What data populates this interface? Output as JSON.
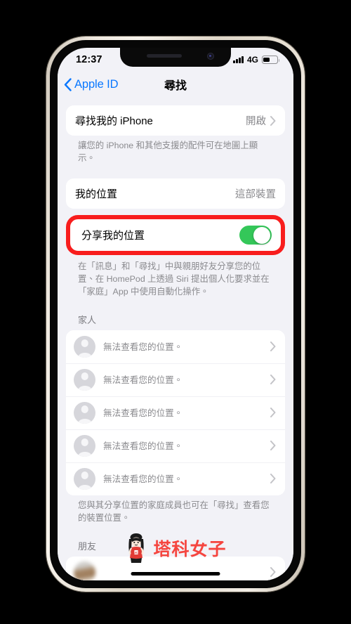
{
  "status_bar": {
    "time": "12:37",
    "network": "4G",
    "signal_icon": "cellular-bars-icon",
    "battery_icon": "battery-icon",
    "battery_level_percent": 48
  },
  "nav": {
    "back_label": "Apple ID",
    "back_icon": "chevron-left-icon",
    "title": "尋找"
  },
  "find_my_section": {
    "row_title": "尋找我的 iPhone",
    "row_value": "開啟",
    "chevron_icon": "chevron-right-icon",
    "footnote": "讓您的 iPhone 和其他支援的配件可在地圖上顯示。"
  },
  "my_location_section": {
    "row_title": "我的位置",
    "row_value": "這部裝置"
  },
  "share_location": {
    "row_title": "分享我的位置",
    "toggle_state": "on",
    "toggle_color": "#34c759",
    "highlight_color": "#f81d1d",
    "footnote": "在「訊息」和「尋找」中與親朋好友分享您的位置、在 HomePod 上透過 Siri 提出個人化要求並在「家庭」App 中使用自動化操作。"
  },
  "family": {
    "header": "家人",
    "members": [
      {
        "name": "",
        "name_blurred": true,
        "subtitle": "無法查看您的位置。",
        "avatar": "person-placeholder-icon",
        "chevron_icon": "chevron-right-icon"
      },
      {
        "name": "",
        "name_blurred": true,
        "subtitle": "無法查看您的位置。",
        "avatar": "person-placeholder-icon",
        "chevron_icon": "chevron-right-icon"
      },
      {
        "name": "",
        "name_blurred": true,
        "subtitle": "無法查看您的位置。",
        "avatar": "person-placeholder-icon",
        "chevron_icon": "chevron-right-icon"
      },
      {
        "name": "",
        "name_blurred": true,
        "subtitle": "無法查看您的位置。",
        "avatar": "person-placeholder-icon",
        "chevron_icon": "chevron-right-icon"
      },
      {
        "name": "",
        "name_blurred": true,
        "subtitle": "無法查看您的位置。",
        "avatar": "person-placeholder-icon",
        "chevron_icon": "chevron-right-icon"
      }
    ],
    "footnote": "您與其分享位置的家庭成員也可在「尋找」查看您的裝置位置。"
  },
  "friends": {
    "header": "朋友",
    "members": [
      {
        "name": "",
        "name_blurred": true,
        "avatar": "contact-photo-blurred",
        "chevron_icon": "chevron-right-icon"
      }
    ]
  },
  "watermark": {
    "text": "塔科女子",
    "color": "#f5453f",
    "mascot_icon": "girl-mascot-icon"
  },
  "home_indicator": {
    "label": "home-indicator"
  }
}
